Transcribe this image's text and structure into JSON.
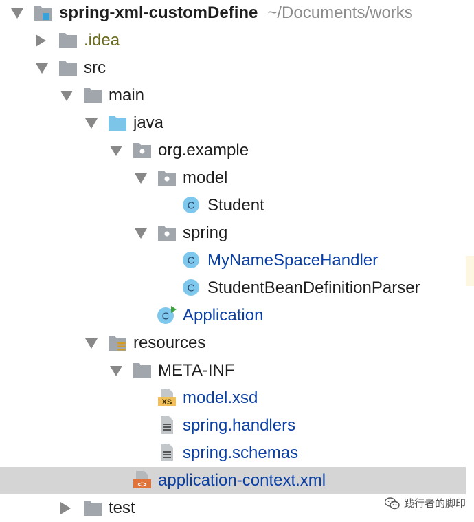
{
  "tree": {
    "rows": [
      {
        "id": "root",
        "depth": 0,
        "arrow": "down",
        "icon": "module-folder",
        "label": "spring-xml-customDefine",
        "path": "~/Documents/works",
        "color": "default",
        "bold": true
      },
      {
        "id": "idea",
        "depth": 1,
        "arrow": "right",
        "icon": "folder-gray",
        "label": ".idea",
        "color": "olive"
      },
      {
        "id": "src",
        "depth": 1,
        "arrow": "down",
        "icon": "folder-gray",
        "label": "src",
        "color": "default"
      },
      {
        "id": "main",
        "depth": 2,
        "arrow": "down",
        "icon": "folder-gray",
        "label": "main",
        "color": "default"
      },
      {
        "id": "java",
        "depth": 3,
        "arrow": "down",
        "icon": "folder-blue",
        "label": "java",
        "color": "default"
      },
      {
        "id": "org-example",
        "depth": 4,
        "arrow": "down",
        "icon": "package",
        "label": "org.example",
        "color": "default"
      },
      {
        "id": "model",
        "depth": 5,
        "arrow": "down",
        "icon": "package",
        "label": "model",
        "color": "default"
      },
      {
        "id": "student",
        "depth": 6,
        "arrow": "none",
        "icon": "class",
        "label": "Student",
        "color": "default"
      },
      {
        "id": "spring",
        "depth": 5,
        "arrow": "down",
        "icon": "package",
        "label": "spring",
        "color": "default"
      },
      {
        "id": "handler",
        "depth": 6,
        "arrow": "none",
        "icon": "class",
        "label": "MyNameSpaceHandler",
        "color": "blue"
      },
      {
        "id": "parser",
        "depth": 6,
        "arrow": "none",
        "icon": "class",
        "label": "StudentBeanDefinitionParser",
        "color": "default"
      },
      {
        "id": "application",
        "depth": 5,
        "arrow": "none",
        "icon": "class-runnable",
        "label": "Application",
        "color": "blue"
      },
      {
        "id": "resources",
        "depth": 3,
        "arrow": "down",
        "icon": "resources-folder",
        "label": "resources",
        "color": "default"
      },
      {
        "id": "meta-inf",
        "depth": 4,
        "arrow": "down",
        "icon": "folder-gray",
        "label": "META-INF",
        "color": "default"
      },
      {
        "id": "model-xsd",
        "depth": 5,
        "arrow": "none",
        "icon": "xsd-file",
        "label": "model.xsd",
        "color": "blue"
      },
      {
        "id": "spring-handlers",
        "depth": 5,
        "arrow": "none",
        "icon": "text-file",
        "label": "spring.handlers",
        "color": "blue"
      },
      {
        "id": "spring-schemas",
        "depth": 5,
        "arrow": "none",
        "icon": "text-file",
        "label": "spring.schemas",
        "color": "blue"
      },
      {
        "id": "app-context",
        "depth": 4,
        "arrow": "none",
        "icon": "xml-file",
        "label": "application-context.xml",
        "color": "blue",
        "selected": true
      },
      {
        "id": "test",
        "depth": 2,
        "arrow": "right",
        "icon": "folder-gray",
        "label": "test",
        "color": "default"
      }
    ]
  },
  "watermark": {
    "text": "践行者的脚印",
    "icon": "wechat-icon"
  },
  "colors": {
    "selection": "#d5d5d5",
    "link_blue": "#0a3fa3",
    "olive": "#6a6a1e",
    "folder_gray": "#a0a6ab",
    "folder_blue": "#7cc4e8",
    "class_icon": "#7ec8ee",
    "xml_orange": "#e0733a"
  }
}
